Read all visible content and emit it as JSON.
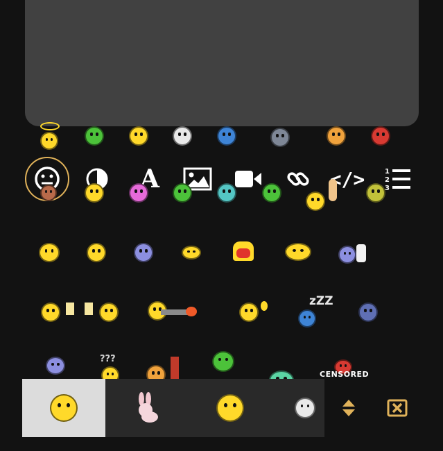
{
  "accent": "#e0b25a",
  "preview": {
    "label": "emoji preview area"
  },
  "emoji_rows": [
    {
      "row": 1,
      "items": [
        "angel",
        "sick",
        "smile",
        "clown",
        "sad",
        "angry-gray",
        "smirk",
        "mad-red"
      ]
    },
    {
      "row": 2,
      "items": [
        "grin",
        "shocked-pink",
        "tongue-green",
        "kiss-teal",
        "whistle",
        "cool",
        "peace",
        "meh"
      ]
    },
    {
      "row": 3,
      "items": [
        "big-grin",
        "heart-eyes",
        "dizzy",
        "bird",
        "butt",
        "yawn",
        "thumbs-up"
      ]
    },
    {
      "row": 4,
      "items": [
        "cheers",
        "gunner",
        "wave",
        "sleeping",
        "skeptic"
      ]
    },
    {
      "row": 5,
      "items": [
        "bandit",
        "confused",
        "bricks",
        "green-wings",
        "mint",
        "censored"
      ]
    }
  ],
  "text": {
    "zzz": "zZZ",
    "question": "???",
    "censored": "CENSORED"
  },
  "toolbar": [
    {
      "name": "emoji",
      "icon": "emoji-face-icon",
      "active": true
    },
    {
      "name": "contrast",
      "icon": "contrast-icon",
      "active": false
    },
    {
      "name": "font",
      "icon": "font-icon",
      "glyph": "A",
      "active": false
    },
    {
      "name": "image",
      "icon": "image-icon",
      "active": false
    },
    {
      "name": "video",
      "icon": "video-icon",
      "active": false
    },
    {
      "name": "link",
      "icon": "link-icon",
      "active": false
    },
    {
      "name": "code",
      "icon": "code-icon",
      "glyph": "</>",
      "active": false
    },
    {
      "name": "ordered-list",
      "icon": "ordered-list-icon",
      "active": false
    }
  ],
  "tabs": [
    {
      "name": "smileys",
      "icon": "smiley-icon",
      "active": true
    },
    {
      "name": "animals",
      "icon": "bunny-icon",
      "active": false
    },
    {
      "name": "grins",
      "icon": "grin-icon",
      "active": false
    },
    {
      "name": "misc",
      "icon": "white-smiley-icon",
      "active": false
    }
  ],
  "controls": [
    {
      "name": "sort",
      "icon": "sort-icon"
    },
    {
      "name": "close",
      "icon": "close-box-icon"
    }
  ]
}
